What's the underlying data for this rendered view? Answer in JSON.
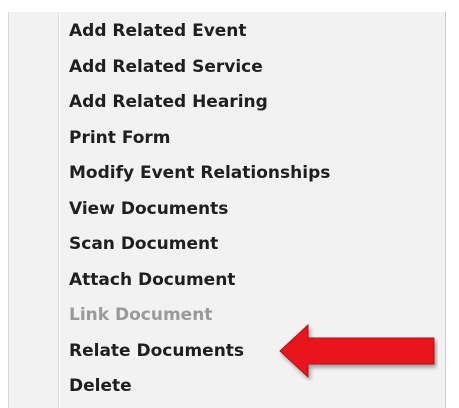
{
  "menu": {
    "items": [
      {
        "label": "Add Related Event",
        "enabled": true
      },
      {
        "label": "Add Related Service",
        "enabled": true
      },
      {
        "label": "Add Related Hearing",
        "enabled": true
      },
      {
        "label": "Print Form",
        "enabled": true
      },
      {
        "label": "Modify Event Relationships",
        "enabled": true
      },
      {
        "label": "View Documents",
        "enabled": true
      },
      {
        "label": "Scan Document",
        "enabled": true
      },
      {
        "label": "Attach Document",
        "enabled": true
      },
      {
        "label": "Link Document",
        "enabled": false
      },
      {
        "label": "Relate Documents",
        "enabled": true
      },
      {
        "label": "Delete",
        "enabled": true
      }
    ]
  },
  "annotation": {
    "arrow_color": "#e8141c",
    "arrow_icon": "left-arrow-icon"
  },
  "colors": {
    "menu_background": "#f2f2f2",
    "text": "#1f1f1f",
    "disabled_text": "#9a9a9a"
  }
}
